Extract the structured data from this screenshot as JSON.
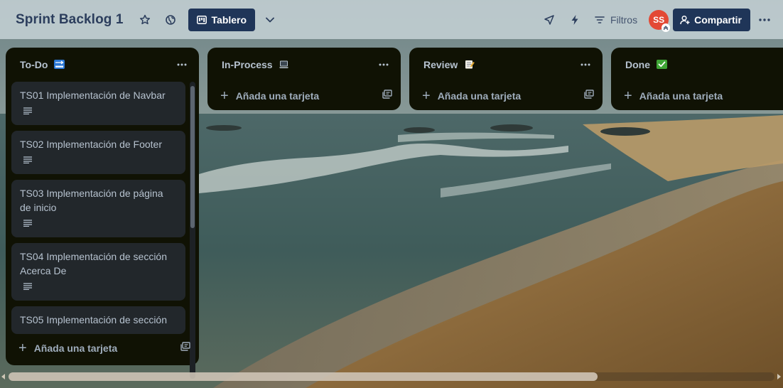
{
  "header": {
    "board_title": "Sprint Backlog 1",
    "view_label": "Tablero",
    "filter_label": "Filtros",
    "avatar_initials": "SS",
    "share_label": "Compartir"
  },
  "lists": [
    {
      "title": "To-Do",
      "emoji": "soon-arrow-icon",
      "cards": [
        {
          "text": "TS01 Implementación de Navbar",
          "has_description": true
        },
        {
          "text": "TS02 Implementación de Footer",
          "has_description": true
        },
        {
          "text": "TS03 Implementación de página de inicio",
          "has_description": true
        },
        {
          "text": "TS04 Implementación de sección Acerca De",
          "has_description": true
        },
        {
          "text": "TS05 Implementación de sección",
          "has_description": false
        }
      ],
      "add_card_label": "Añada una tarjeta"
    },
    {
      "title": "In-Process",
      "emoji": "laptop-icon",
      "cards": [],
      "add_card_label": "Añada una tarjeta"
    },
    {
      "title": "Review",
      "emoji": "memo-icon",
      "cards": [],
      "add_card_label": "Añada una tarjeta"
    },
    {
      "title": "Done",
      "emoji": "check-mark-icon",
      "cards": [],
      "add_card_label": "Añada una tarjeta"
    }
  ],
  "colors": {
    "header_bg": "#c4d0d4",
    "button_bg": "#1f3558",
    "list_bg": "#101204",
    "card_bg": "#22272b",
    "text": "#b6c2cf",
    "avatar_bg": "#e34935",
    "done_check": "#3fa535",
    "soon_blue": "#2b78d6"
  }
}
